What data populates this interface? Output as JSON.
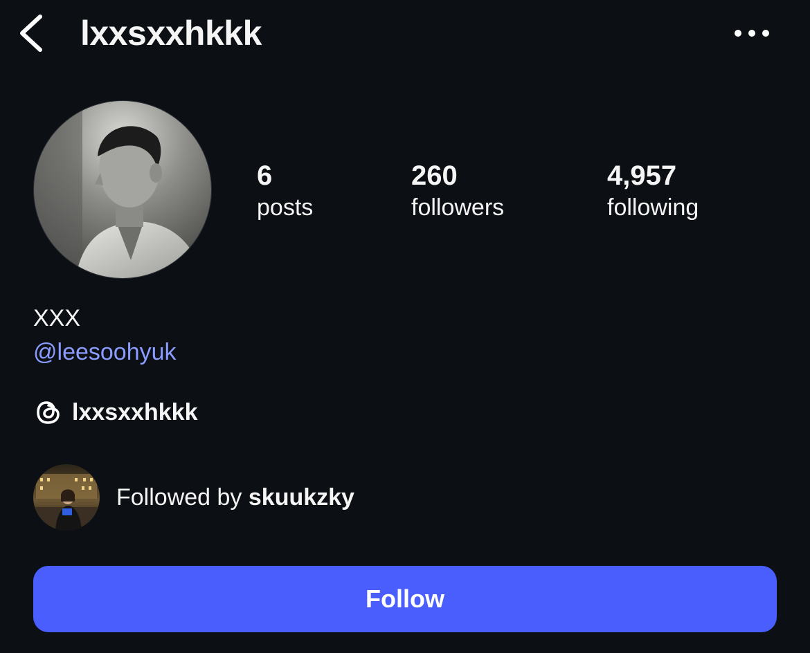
{
  "header": {
    "username": "lxxsxxhkkk",
    "back_icon": "chevron-left-icon",
    "more_icon": "more-horizontal-icon"
  },
  "profile": {
    "avatar_icon": "profile-photo",
    "stats": {
      "posts_value": "6",
      "posts_label": "posts",
      "followers_value": "260",
      "followers_label": "followers",
      "following_value": "4,957",
      "following_label": "following"
    },
    "display_name": "XXX",
    "bio_mention": "@leesoohyuk",
    "threads": {
      "icon": "threads-icon",
      "name": "lxxsxxhkkk"
    },
    "followed_by": {
      "prefix": "Followed by",
      "name": "skuukzky",
      "avatar_icon": "mutual-follower-photo"
    },
    "follow_button_label": "Follow"
  },
  "colors": {
    "background": "#0c1014",
    "text": "#f5f5f5",
    "link": "#8a9cff",
    "accent": "#4a5dfd"
  }
}
